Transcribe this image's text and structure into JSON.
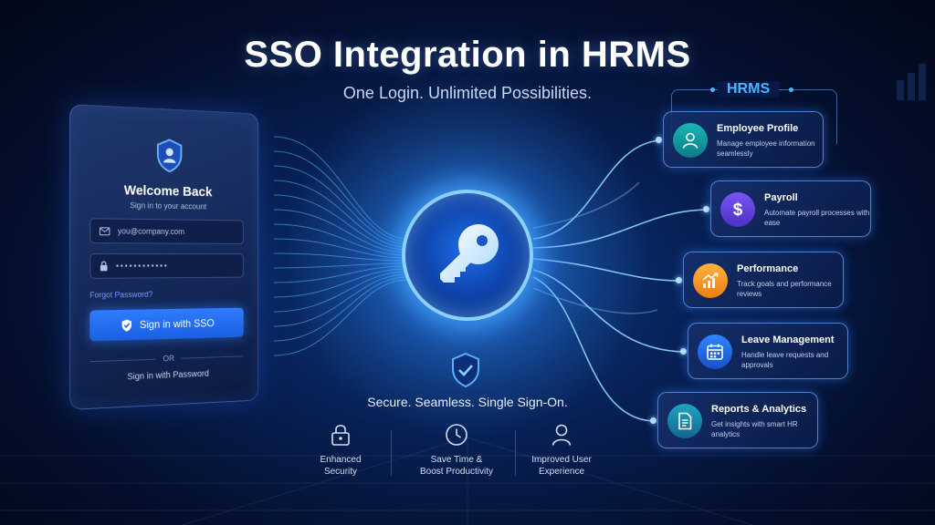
{
  "header": {
    "title": "SSO Integration in HRMS",
    "subtitle": "One Login. Unlimited Possibilities."
  },
  "login": {
    "welcome": "Welcome Back",
    "subtitle": "Sign in to your account",
    "email_placeholder": "you@company.com",
    "password_mask": "••••••••••••",
    "forgot_password": "Forgot Password?",
    "sso_button": "Sign in with SSO",
    "or_label": "OR",
    "password_signin": "Sign in with Password"
  },
  "center": {
    "key_icon": "key-icon",
    "tagline": "Secure. Seamless. Single Sign-On."
  },
  "benefits": [
    {
      "icon": "lock-icon",
      "line1": "Enhanced",
      "line2": "Security"
    },
    {
      "icon": "clock-icon",
      "line1": "Save Time &",
      "line2": "Boost Productivity"
    },
    {
      "icon": "user-icon",
      "line1": "Improved User",
      "line2": "Experience"
    }
  ],
  "hrms": {
    "label": "HRMS",
    "accent_color": "#4fb4ff",
    "modules": [
      {
        "title": "Employee Profile",
        "desc": "Manage employee information seamlessly",
        "icon": "user-circle-icon",
        "color": "#1ab6b4"
      },
      {
        "title": "Payroll",
        "desc": "Automate payroll processes with ease",
        "icon": "dollar-icon",
        "color": "#7a55f3"
      },
      {
        "title": "Performance",
        "desc": "Track goals and performance reviews",
        "icon": "chart-growth-icon",
        "color": "#ffb13b"
      },
      {
        "title": "Leave Management",
        "desc": "Handle leave requests and approvals",
        "icon": "calendar-icon",
        "color": "#2f86ff"
      },
      {
        "title": "Reports & Analytics",
        "desc": "Get insights with smart HR analytics",
        "icon": "report-icon",
        "color": "#20a6c4"
      }
    ]
  }
}
